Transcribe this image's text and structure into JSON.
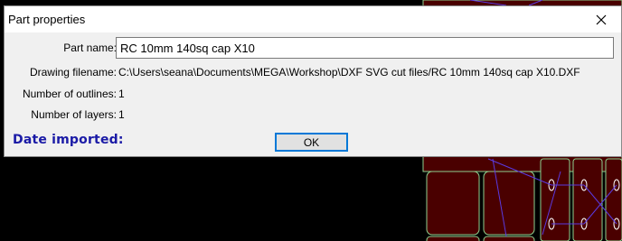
{
  "dialog": {
    "title": "Part properties",
    "fields": {
      "part_name_label": "Part name:",
      "part_name_value": "RC 10mm 140sq cap X10",
      "drawing_filename_label": "Drawing filename:",
      "drawing_filename_value": "C:\\Users\\seana\\Documents\\MEGA\\Workshop\\DXF  SVG cut files/RC 10mm 140sq cap X10.DXF",
      "outlines_label": "Number of outlines:",
      "outlines_value": "1",
      "layers_label": "Number of layers:",
      "layers_value": "1",
      "date_imported_label": "Date imported:"
    },
    "ok_label": "OK"
  },
  "colors": {
    "canvas_bg": "#000000",
    "part_fill": "#4a0000",
    "outline": "#8fd18f",
    "path": "#5a3ae0",
    "date_label": "#1a1aa6",
    "focus": "#0078d7"
  },
  "icons": {
    "close": "close-icon"
  }
}
